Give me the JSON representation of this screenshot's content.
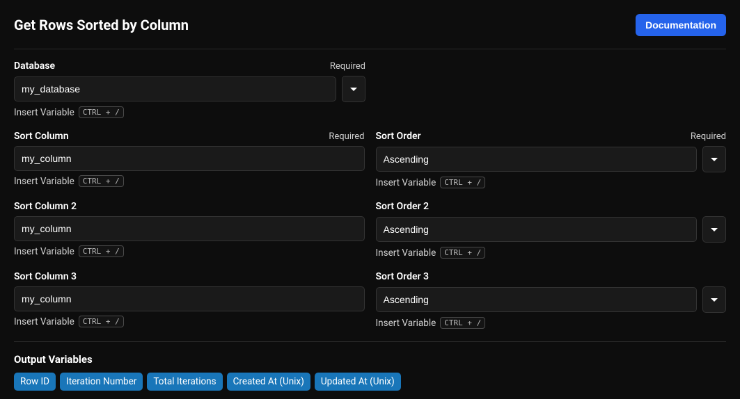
{
  "header": {
    "title": "Get Rows Sorted by Column",
    "doc_button": "Documentation"
  },
  "labels": {
    "required": "Required",
    "insert_variable": "Insert Variable",
    "shortcut": "CTRL + /"
  },
  "fields": {
    "database": {
      "label": "Database",
      "value": "my_database"
    },
    "sort_column": {
      "label": "Sort Column",
      "value": "my_column"
    },
    "sort_order": {
      "label": "Sort Order",
      "value": "Ascending"
    },
    "sort_column_2": {
      "label": "Sort Column 2",
      "value": "my_column"
    },
    "sort_order_2": {
      "label": "Sort Order 2",
      "value": "Ascending"
    },
    "sort_column_3": {
      "label": "Sort Column 3",
      "value": "my_column"
    },
    "sort_order_3": {
      "label": "Sort Order 3",
      "value": "Ascending"
    }
  },
  "output": {
    "title": "Output Variables",
    "pills": {
      "row_id": "Row ID",
      "iteration_number": "Iteration Number",
      "total_iterations": "Total Iterations",
      "created_at": "Created At (Unix)",
      "updated_at": "Updated At (Unix)"
    }
  }
}
